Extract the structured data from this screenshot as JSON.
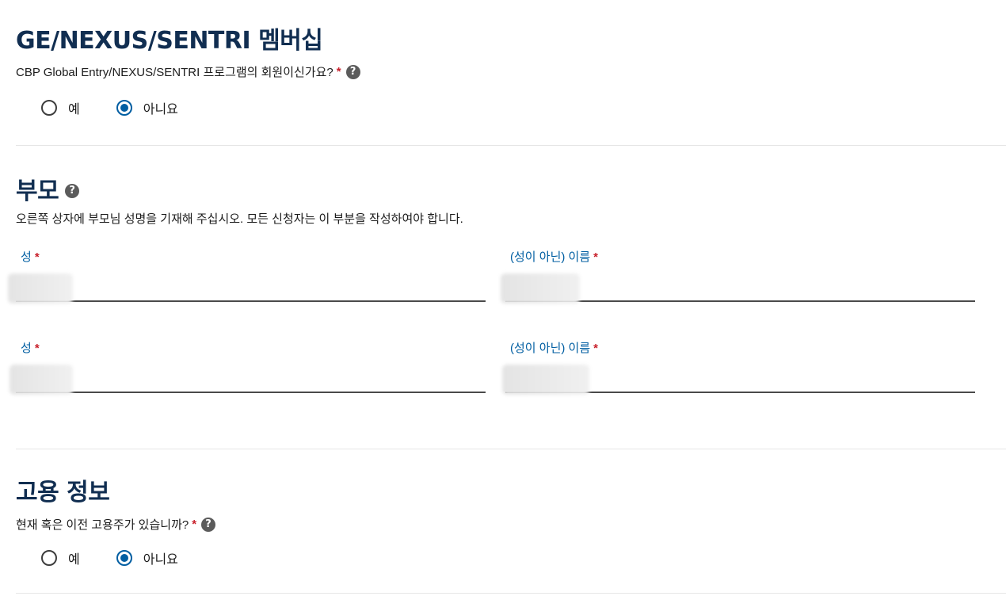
{
  "membership": {
    "title": "GE/NEXUS/SENTRI 멤버십",
    "question": "CBP Global Entry/NEXUS/SENTRI 프로그램의 회원이신가요?",
    "required_mark": "*",
    "help_glyph": "?",
    "options": [
      {
        "label": "예",
        "checked": false
      },
      {
        "label": "아니요",
        "checked": true
      }
    ]
  },
  "parents": {
    "title": "부모",
    "help_glyph": "?",
    "description": "오른쪽 상자에 부모님 성명을 기재해 주십시오. 모든 신청자는 이 부분을 작성하여야 합니다.",
    "required_mark": "*",
    "rows": [
      {
        "last_label": "성",
        "first_label": "(성이 아닌) 이름",
        "last_value": "",
        "first_value": ""
      },
      {
        "last_label": "성",
        "first_label": "(성이 아닌) 이름",
        "last_value": "",
        "first_value": ""
      }
    ]
  },
  "employment": {
    "title": "고용 정보",
    "question": "현재 혹은 이전 고용주가 있습니까?",
    "required_mark": "*",
    "help_glyph": "?",
    "options": [
      {
        "label": "예",
        "checked": false
      },
      {
        "label": "아니요",
        "checked": true
      }
    ]
  },
  "colors": {
    "heading": "#112e51",
    "link_label": "#005ea2",
    "required": "#c8202b",
    "radio_selected": "#005ea2"
  }
}
